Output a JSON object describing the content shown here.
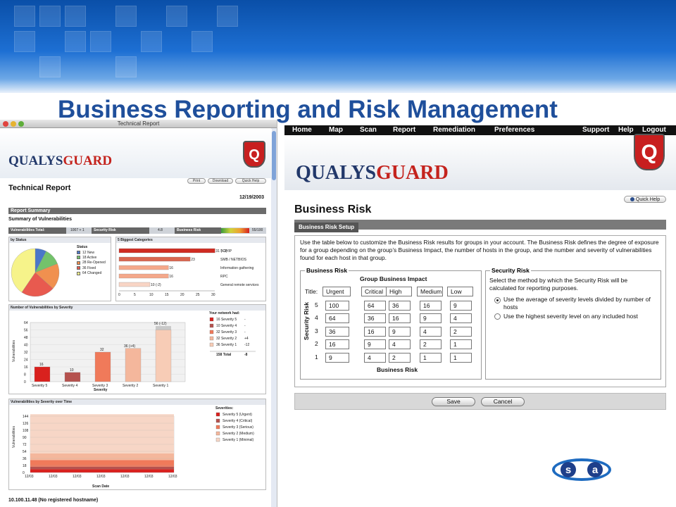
{
  "slide": {
    "title": "Business Reporting and Risk Management"
  },
  "left_window": {
    "window_title": "Technical Report",
    "brand": {
      "part1": "QUALYS",
      "part2": "GUARD"
    },
    "shield_letter": "Q",
    "buttons": {
      "print": "Print",
      "download": "Download",
      "quick_help": "Quick Help"
    },
    "report_title": "Technical Report",
    "date": "12/19/2003",
    "report_summary": "Report Summary",
    "summary_vulns": "Summary of Vulnerabilities",
    "totals": {
      "vuln_total_label": "Vulnerabilities Total:",
      "vuln_total_value": "1007 + 1",
      "security_risk_label": "Security Risk",
      "security_risk_value": "4.8",
      "business_risk_label": "Business Risk",
      "business_risk_value": "55/100"
    },
    "by_status": {
      "title": "by Status",
      "status_label": "Status",
      "items": [
        {
          "count": "12",
          "label": "New",
          "color": "#4a77c9"
        },
        {
          "count": "18",
          "label": "Active",
          "color": "#73c26b"
        },
        {
          "count": "28",
          "label": "Re-Opened",
          "color": "#f0904f"
        },
        {
          "count": "36",
          "label": "Fixed",
          "color": "#e85a4f"
        },
        {
          "count": "64",
          "label": "Changed",
          "color": "#f6f38a"
        }
      ]
    },
    "categories": {
      "title": "5 Biggest Categories",
      "items": [
        {
          "label": "TCP/IP",
          "value": 31,
          "text": "31 (+1)"
        },
        {
          "label": "SMB / NETBIOS",
          "value": 23,
          "text": "23"
        },
        {
          "label": "Information gathering",
          "value": 16,
          "text": "16"
        },
        {
          "label": "RPC",
          "value": 16,
          "text": "16"
        },
        {
          "label": "General remote services",
          "value": 10,
          "text": "10 (-2)"
        }
      ],
      "ticks": [
        "0",
        "5",
        "10",
        "15",
        "20",
        "25",
        "30"
      ]
    },
    "by_severity": {
      "title": "Number of Vulnerabilities by Severity",
      "ylabel": "Vulnerabilities",
      "xlabel": "Severity",
      "network_had": "Your network had:",
      "ticks": [
        "0",
        "8",
        "16",
        "24",
        "32",
        "40",
        "48",
        "56",
        "64"
      ],
      "bars": [
        {
          "cat": "Severity 5",
          "value": 16,
          "label": "16",
          "color": "#d9211e"
        },
        {
          "cat": "Severity 4",
          "value": 10,
          "label": "10",
          "color": "#b5524e"
        },
        {
          "cat": "Severity 3",
          "value": 32,
          "label": "32",
          "color": "#f07a5a"
        },
        {
          "cat": "Severity 2",
          "value": 36,
          "label": "36 (+4)",
          "color": "#f4b79c"
        },
        {
          "cat": "Severity 1",
          "value": 56,
          "label": "56 (-12)",
          "color": "#f7ccb6"
        }
      ],
      "legend": [
        {
          "text": "16 Severity 5",
          "delta": "-"
        },
        {
          "text": "10 Severity 4",
          "delta": "-"
        },
        {
          "text": "32 Severity 3",
          "delta": "-"
        },
        {
          "text": "32 Severity 2",
          "delta": "+4"
        },
        {
          "text": "36 Severity 1",
          "delta": "-12"
        }
      ],
      "total": "158 Total",
      "total_delta": "-8"
    },
    "over_time": {
      "title": "Vulnerabilities by Severity over Time",
      "ylabel": "Vulnerabilities",
      "xlabel": "Scan Date",
      "ticks": [
        "0",
        "18",
        "36",
        "54",
        "72",
        "90",
        "108",
        "126",
        "144"
      ],
      "dates": [
        "12/03",
        "12/03",
        "12/03",
        "12/03",
        "12/03",
        "12/03",
        "12/03"
      ],
      "severities_title": "Severities:",
      "legend": [
        "Severity 5 (Urgent)",
        "Severity 4 (Critical)",
        "Severity 3 (Serious)",
        "Severity 2 (Medium)",
        "Severity 1 (Minimal)"
      ],
      "colors": [
        "#d9211e",
        "#b5524e",
        "#f07a5a",
        "#f4b79c",
        "#f7d6c6"
      ]
    },
    "host_line": "10.100.11.48 (No registered hostname)"
  },
  "right_window": {
    "nav_left": [
      "Home",
      "Map",
      "Scan",
      "Report",
      "Remediation",
      "Preferences"
    ],
    "nav_right": [
      "Support",
      "Help",
      "Logout"
    ],
    "brand": {
      "part1": "QUALYS",
      "part2": "GUARD"
    },
    "shield_letter": "Q",
    "quick_help": "Quick Help",
    "page_title": "Business Risk",
    "setup_tab": "Business Risk Setup",
    "intro": "Use the table below to customize the Business Risk results for groups in your account.  The Business Risk defines the degree of exposure for a group depending on the group’s Business Impact, the number of hosts in the group, and the number and severity of vulnerabilities found for each host in that group.",
    "business_risk": {
      "legend": "Business Risk",
      "group_impact": "Group Business Impact",
      "title_label": "Title:",
      "columns": [
        "Urgent",
        "Critical",
        "High",
        "Medium",
        "Low"
      ],
      "security_risk_axis": "Security Risk",
      "rows": [
        {
          "level": "5",
          "values": [
            "100",
            "64",
            "36",
            "16",
            "9"
          ]
        },
        {
          "level": "4",
          "values": [
            "64",
            "36",
            "16",
            "9",
            "4"
          ]
        },
        {
          "level": "3",
          "values": [
            "36",
            "16",
            "9",
            "4",
            "2"
          ]
        },
        {
          "level": "2",
          "values": [
            "16",
            "9",
            "4",
            "2",
            "1"
          ]
        },
        {
          "level": "1",
          "values": [
            "9",
            "4",
            "2",
            "1",
            "1"
          ]
        }
      ],
      "footer": "Business Risk"
    },
    "security_risk": {
      "legend": "Security Risk",
      "description": "Select the method by which the Security Risk will be calculated for reporting purposes.",
      "options": [
        {
          "label": "Use the average of severity levels divided by number of hosts",
          "selected": true
        },
        {
          "label": "Use the highest severity level on any included host",
          "selected": false
        }
      ]
    },
    "buttons": {
      "save": "Save",
      "cancel": "Cancel"
    }
  },
  "corner_logo": {
    "letters": [
      "s",
      "a"
    ]
  }
}
